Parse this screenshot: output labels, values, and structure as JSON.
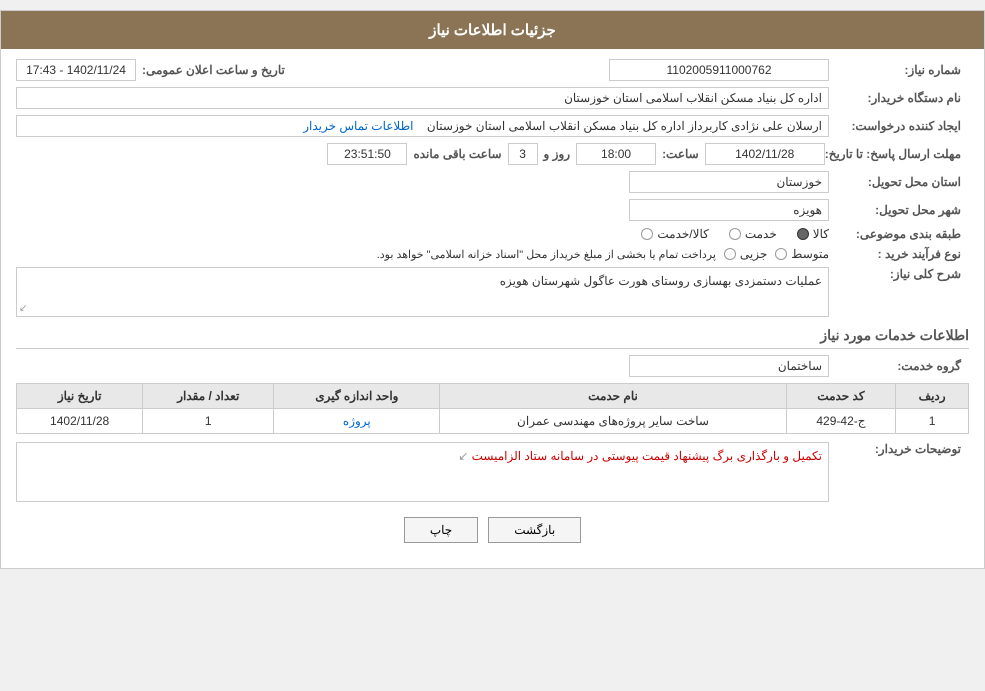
{
  "header": {
    "title": "جزئیات اطلاعات نیاز"
  },
  "fields": {
    "niyaz_number_label": "شماره نیاز:",
    "niyaz_number_value": "1102005911000762",
    "buyer_org_label": "نام دستگاه خریدار:",
    "buyer_org_value": "اداره کل بنیاد مسکن انقلاب اسلامی استان خوزستان",
    "creator_label": "ایجاد کننده درخواست:",
    "creator_value": "ارسلان علی نژادی کاربرداز اداره کل بنیاد مسکن انقلاب اسلامی استان خوزستان",
    "contact_link": "اطلاعات تماس خریدار",
    "send_deadline_label": "مهلت ارسال پاسخ: تا تاریخ:",
    "send_date": "1402/11/28",
    "send_time_label": "ساعت:",
    "send_time": "18:00",
    "send_day_label": "روز و",
    "send_days": "3",
    "send_remaining_label": "ساعت باقی مانده",
    "send_remaining": "23:51:50",
    "province_label": "استان محل تحویل:",
    "province_value": "خوزستان",
    "city_label": "شهر محل تحویل:",
    "city_value": "هویزه",
    "category_label": "طبقه بندی موضوعی:",
    "category_options": [
      "کالا",
      "خدمت",
      "کالا/خدمت"
    ],
    "category_selected": "کالا",
    "process_label": "نوع فرآیند خرید :",
    "process_options": [
      "جزیی",
      "متوسط"
    ],
    "process_note": "پرداخت تمام یا بخشی از مبلغ خریداز محل \"اسناد خزانه اسلامی\" خواهد بود.",
    "description_label": "شرح کلی نیاز:",
    "description_value": "عملیات دستمزدی بهسازی روستای هورت عاگول  شهرستان هویزه",
    "services_section": "اطلاعات خدمات مورد نیاز",
    "service_group_label": "گروه خدمت:",
    "service_group_value": "ساختمان",
    "table_headers": [
      "ردیف",
      "کد حدمت",
      "نام حدمت",
      "واحد اندازه گیری",
      "تعداد / مقدار",
      "تاریخ نیاز"
    ],
    "table_rows": [
      {
        "row": "1",
        "code": "ج-42-429",
        "name": "ساخت سایر پروژه‌های مهندسی عمران",
        "unit": "پروژه",
        "count": "1",
        "date": "1402/11/28"
      }
    ],
    "buyer_desc_label": "توضیحات خریدار:",
    "buyer_desc_value": "تکمیل و بارگذاری برگ پیشنهاد قیمت پیوستی در سامانه ستاد الزامیست",
    "btn_print": "چاپ",
    "btn_back": "بازگشت",
    "announce_label": "تاریخ و ساعت اعلان عمومی:",
    "announce_date_value": "1402/11/24 - 17:43"
  }
}
